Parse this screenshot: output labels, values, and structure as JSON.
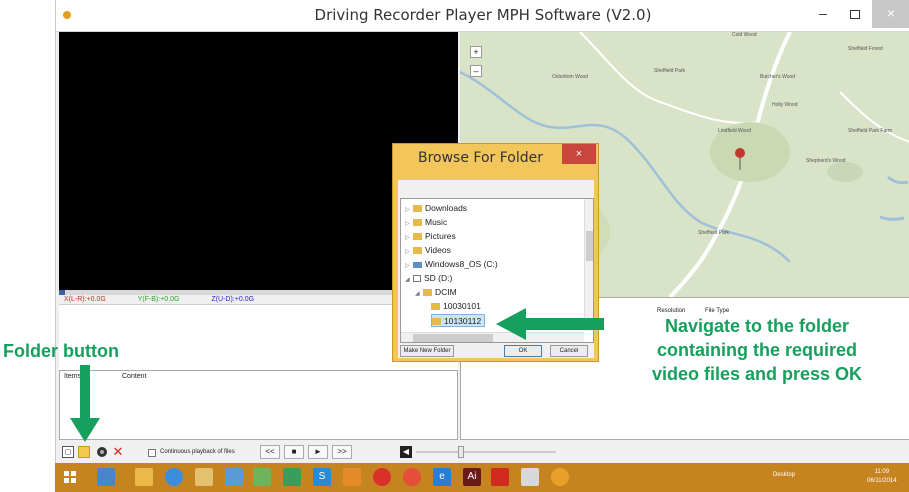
{
  "window": {
    "title": "Driving Recorder Player MPH Software (V2.0)",
    "controls": {
      "minimize": "–",
      "close": "×"
    }
  },
  "gsensor": {
    "x": "X(L-R):+0.0G",
    "y": "Y(F-B):+0.0G",
    "z": "Z(U-D):+0.0G"
  },
  "info_panel": {
    "col1": "Items",
    "col2": "Content"
  },
  "map": {
    "zoom_in": "+",
    "zoom_out": "–",
    "labels": [
      "Sheffield Park",
      "Sheffield Park Farm",
      "Sheffield Park",
      "Sheffield Forest",
      "Shepherd's Wood",
      "Oxbottom Wood",
      "Lindfield Wood",
      "Butcher's Wood",
      "Holly Wood",
      "Cold Wood"
    ]
  },
  "right_panel": {
    "resolution": "Resolution",
    "file_type": "File Type"
  },
  "toolbar": {
    "continuous_label": "Continuous playback of files",
    "rewind": "<<",
    "stop": "■",
    "play": "►",
    "forward": ">>"
  },
  "dialog": {
    "title": "Browse For Folder",
    "close": "×",
    "tree": [
      "Downloads",
      "Music",
      "Pictures",
      "Videos",
      "Windows8_OS (C:)",
      "SD (D:)",
      "DCIM",
      "10030101",
      "10130112"
    ],
    "make_new_folder": "Make New Folder",
    "ok": "OK",
    "cancel": "Cancel"
  },
  "annotations": {
    "folder_button": "Folder button",
    "navigate": [
      "Navigate to the folder",
      "containing the required",
      "video files and press OK"
    ]
  },
  "taskbar": {
    "tray_text": "Desktop",
    "time": "11:09",
    "date": "06/11/2014"
  },
  "colors": {
    "annotation_green": "#16a05d",
    "dialog_border": "#f3c65b",
    "taskbar": "#c68421",
    "dialog_close": "#c9463d"
  }
}
